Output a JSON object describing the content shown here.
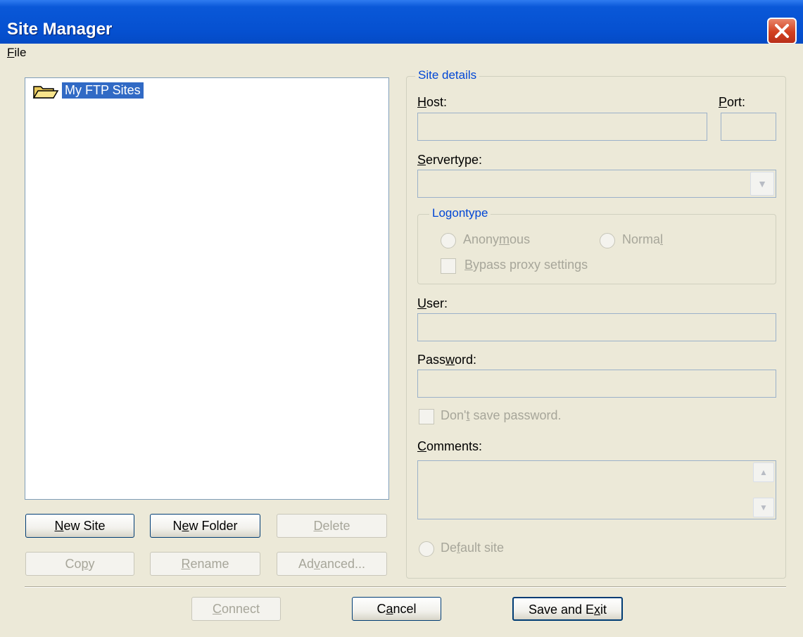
{
  "window": {
    "title": "Site Manager",
    "close_icon": "close-icon"
  },
  "menu": {
    "file": {
      "mnemonic": "F",
      "rest": "ile"
    }
  },
  "tree": {
    "root_label": "My FTP Sites",
    "root_icon": "folder-open-icon"
  },
  "left_buttons": {
    "new_site": {
      "mnemonic": "N",
      "rest": "ew Site"
    },
    "new_folder": {
      "pre": "N",
      "mnemonic": "e",
      "rest": "w Folder"
    },
    "delete": {
      "mnemonic": "D",
      "rest": "elete"
    },
    "copy": {
      "pre": "Co",
      "mnemonic": "p",
      "rest": "y"
    },
    "rename": {
      "mnemonic": "R",
      "rest": "ename"
    },
    "advanced": {
      "pre": "Ad",
      "mnemonic": "v",
      "rest": "anced..."
    }
  },
  "site_details": {
    "group_title": "Site details",
    "host": {
      "mnemonic": "H",
      "rest": "ost:",
      "value": ""
    },
    "port": {
      "mnemonic": "P",
      "rest": "ort:",
      "value": ""
    },
    "servertype": {
      "mnemonic": "S",
      "rest": "ervertype:",
      "value": ""
    },
    "logontype": {
      "title": "Logontype",
      "anonymous": {
        "pre": "Anony",
        "mnemonic": "m",
        "rest": "ous"
      },
      "normal": {
        "pre": "Norma",
        "mnemonic": "l",
        "rest": ""
      },
      "bypass": {
        "mnemonic": "B",
        "rest": "ypass proxy settings"
      }
    },
    "user": {
      "mnemonic": "U",
      "rest": "ser:",
      "value": ""
    },
    "password": {
      "pre": "Pass",
      "mnemonic": "w",
      "rest": "ord:",
      "value": ""
    },
    "dont_save": {
      "pre": "Don'",
      "mnemonic": "t",
      "rest": " save password."
    },
    "comments": {
      "mnemonic": "C",
      "rest": "omments:",
      "value": ""
    },
    "default_site": {
      "pre": "De",
      "mnemonic": "f",
      "rest": "ault site"
    }
  },
  "bottom_buttons": {
    "connect": {
      "mnemonic": "C",
      "rest": "onnect"
    },
    "cancel": {
      "pre": "C",
      "mnemonic": "a",
      "rest": "ncel"
    },
    "save_exit": {
      "pre": "Save and E",
      "mnemonic": "x",
      "rest": "it"
    }
  },
  "colors": {
    "titlebar": "#0550d0",
    "selection": "#316ac5",
    "group_title": "#0046d5",
    "disabled_text": "#a7a69a"
  }
}
